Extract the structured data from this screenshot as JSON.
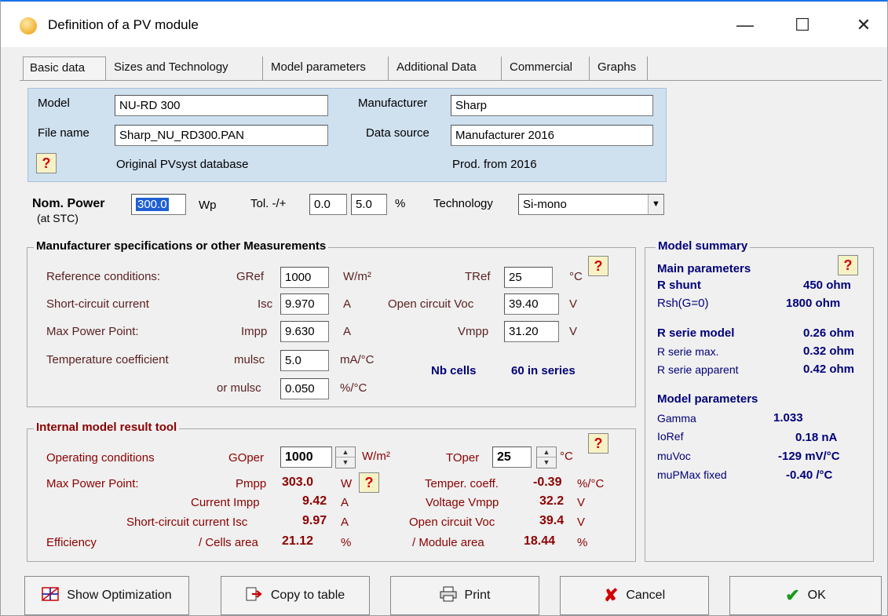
{
  "window": {
    "title": "Definition of a PV module",
    "minimize": "—",
    "maximize": "☐",
    "close": "✕"
  },
  "tabs": [
    "Basic data",
    "Sizes and Technology",
    "Model parameters",
    "Additional Data",
    "Commercial",
    "Graphs"
  ],
  "basic": {
    "model_label": "Model",
    "model_value": "NU-RD 300",
    "manufacturer_label": "Manufacturer",
    "manufacturer_value": "Sharp",
    "filename_label": "File name",
    "filename_value": "Sharp_NU_RD300.PAN",
    "datasource_label": "Data source",
    "datasource_value": "Manufacturer 2016",
    "database_note": "Original PVsyst database",
    "prod_note": "Prod. from 2016",
    "help": "?"
  },
  "nominal": {
    "label": "Nom. Power",
    "sublabel": "(at STC)",
    "value": "300.0",
    "unit": "Wp",
    "tol_label": "Tol. -/+",
    "tol_minus": "0.0",
    "tol_plus": "5.0",
    "tol_unit": "%",
    "tech_label": "Technology",
    "tech_value": "Si-mono"
  },
  "specs": {
    "title": "Manufacturer specifications  or  other Measurements",
    "ref_label": "Reference conditions:",
    "gref_label": "GRef",
    "gref_value": "1000",
    "gref_unit": "W/m²",
    "tref_label": "TRef",
    "tref_value": "25",
    "tref_unit": "°C",
    "isc_row_label": "Short-circuit current",
    "isc_label": "Isc",
    "isc_value": "9.970",
    "isc_unit": "A",
    "voc_label": "Open circuit Voc",
    "voc_value": "39.40",
    "voc_unit": "V",
    "mpp_row_label": "Max Power Point:",
    "impp_label": "Impp",
    "impp_value": "9.630",
    "impp_unit": "A",
    "vmpp_label": "Vmpp",
    "vmpp_value": "31.20",
    "vmpp_unit": "V",
    "temp_row_label": "Temperature coefficient",
    "mulsc_label": "mulsc",
    "mulsc_value": "5.0",
    "mulsc_unit": "mA/°C",
    "or_mulsc_label": "or mulsc",
    "or_mulsc_value": "0.050",
    "or_mulsc_unit": "%/°C",
    "cells_label": "Nb cells",
    "cells_value": "60 in series"
  },
  "internal": {
    "title": "Internal model result tool",
    "op_label": "Operating conditions",
    "goper_label": "GOper",
    "goper_value": "1000",
    "goper_unit": "W/m²",
    "toper_label": "TOper",
    "toper_value": "25",
    "toper_unit": "°C",
    "mpp_label": "Max Power Point:",
    "pmpp_label": "Pmpp",
    "pmpp_value": "303.0",
    "pmpp_unit": "W",
    "temper_label": "Temper. coeff.",
    "temper_value": "-0.39",
    "temper_unit": "%/°C",
    "impp_label": "Current Impp",
    "impp_value": "9.42",
    "impp_unit": "A",
    "vmpp_label": "Voltage Vmpp",
    "vmpp_value": "32.2",
    "vmpp_unit": "V",
    "isc_label": "Short-circuit current Isc",
    "isc_value": "9.97",
    "isc_unit": "A",
    "voc_label": "Open circuit Voc",
    "voc_value": "39.4",
    "voc_unit": "V",
    "eff_label": "Efficiency",
    "cells_area_label": "/ Cells area",
    "cells_area_value": "21.12",
    "cells_area_unit": "%",
    "module_area_label": "/ Module area",
    "module_area_value": "18.44",
    "module_area_unit": "%"
  },
  "summary": {
    "title": "Model summary",
    "main_label": "Main parameters",
    "rshunt_label": "R shunt",
    "rshunt_value": "450 ohm",
    "rsh0_label": "Rsh(G=0)",
    "rsh0_value": "1800 ohm",
    "rserie_label": "R serie model",
    "rserie_value": "0.26 ohm",
    "rseriemax_label": "R serie max.",
    "rseriemax_value": "0.32 ohm",
    "rserieapp_label": "R serie apparent",
    "rserieapp_value": "0.42 ohm",
    "model_params_label": "Model parameters",
    "gamma_label": "Gamma",
    "gamma_value": "1.033",
    "ioref_label": "IoRef",
    "ioref_value": "0.18 nA",
    "muvoc_label": "muVoc",
    "muvoc_value": "-129 mV/°C",
    "mupmax_label": "muPMax fixed",
    "mupmax_value": "-0.40 /°C"
  },
  "buttons": {
    "optimization": "Show Optimization",
    "copy": "Copy to table",
    "print": "Print",
    "cancel": "Cancel",
    "ok": "OK"
  }
}
